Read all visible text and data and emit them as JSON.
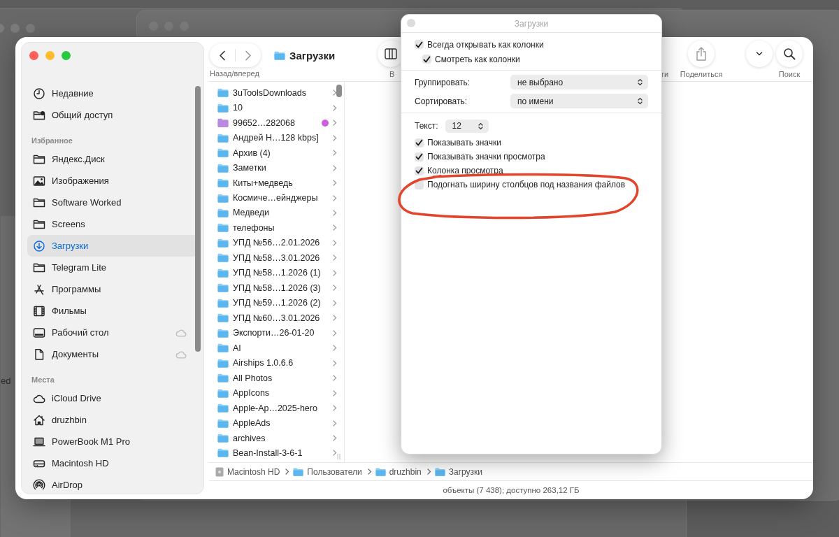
{
  "background": {
    "text": "ed"
  },
  "finder": {
    "sidebar": [
      {
        "items": [
          {
            "label": "Недавние",
            "kind": "clock",
            "selected": false,
            "icloud": false
          },
          {
            "label": "Общий доступ",
            "kind": "shared",
            "selected": false,
            "icloud": false
          }
        ]
      },
      {
        "header": "Избранное",
        "items": [
          {
            "label": "Яндекс.Диск",
            "kind": "folder",
            "selected": false,
            "icloud": false
          },
          {
            "label": "Изображения",
            "kind": "photos",
            "selected": false,
            "icloud": false
          },
          {
            "label": "Software Worked",
            "kind": "folder",
            "selected": false,
            "icloud": false
          },
          {
            "label": "Screens",
            "kind": "folder",
            "selected": false,
            "icloud": false
          },
          {
            "label": "Загрузки",
            "kind": "download",
            "selected": true,
            "icloud": false
          },
          {
            "label": "Telegram Lite",
            "kind": "folder",
            "selected": false,
            "icloud": false
          },
          {
            "label": "Программы",
            "kind": "apps",
            "selected": false,
            "icloud": false
          },
          {
            "label": "Фильмы",
            "kind": "film",
            "selected": false,
            "icloud": false
          },
          {
            "label": "Рабочий стол",
            "kind": "desktop",
            "selected": false,
            "icloud": true
          },
          {
            "label": "Документы",
            "kind": "document",
            "selected": false,
            "icloud": true
          }
        ]
      },
      {
        "header": "Места",
        "items": [
          {
            "label": "iCloud Drive",
            "kind": "cloud",
            "selected": false,
            "icloud": false
          },
          {
            "label": "druzhbin",
            "kind": "home",
            "selected": false,
            "icloud": false
          },
          {
            "label": "PowerBook M1 Pro",
            "kind": "laptop",
            "selected": false,
            "icloud": false
          },
          {
            "label": "Macintosh HD",
            "kind": "disk",
            "selected": false,
            "icloud": false
          },
          {
            "label": "AirDrop",
            "kind": "airdrop",
            "selected": false,
            "icloud": false
          }
        ]
      }
    ],
    "toolbar": {
      "nav_label": "Назад/вперед",
      "title": "Загрузки",
      "items": [
        {
          "kind": "view",
          "label": "В"
        },
        {
          "kind": "tags",
          "label": "ги"
        },
        {
          "kind": "share",
          "label": "Поделиться"
        },
        {
          "kind": "more"
        },
        {
          "kind": "search",
          "label": "Поиск"
        }
      ]
    },
    "column": [
      {
        "name": "3uToolsDownloads"
      },
      {
        "name": "10"
      },
      {
        "name": "99652…282068",
        "color": "#cf5fe0"
      },
      {
        "name": "Андрей Н…128 kbps]"
      },
      {
        "name": "Архив (4)"
      },
      {
        "name": "Заметки"
      },
      {
        "name": "Киты+медведь"
      },
      {
        "name": "Космиче…ейнджеры"
      },
      {
        "name": "Медведи"
      },
      {
        "name": "телефоны"
      },
      {
        "name": "УПД №56…2.01.2026"
      },
      {
        "name": "УПД №58…3.01.2026"
      },
      {
        "name": "УПД №58…1.2026 (1)"
      },
      {
        "name": "УПД №58…1.2026 (3)"
      },
      {
        "name": "УПД №59…1.2026 (2)"
      },
      {
        "name": "УПД №60…3.01.2026"
      },
      {
        "name": "Экспорти…26-01-20"
      },
      {
        "name": "AI"
      },
      {
        "name": "Airships 1.0.6.6"
      },
      {
        "name": "All Photos"
      },
      {
        "name": "AppIcons"
      },
      {
        "name": "Apple-Ap…2025-hero"
      },
      {
        "name": "AppleAds"
      },
      {
        "name": "archives"
      },
      {
        "name": "Bean-Install-3-6-1"
      }
    ],
    "path": [
      {
        "label": "Macintosh HD",
        "kind": "disk"
      },
      {
        "label": "Пользователи",
        "kind": "folder"
      },
      {
        "label": "druzhbin",
        "kind": "home"
      },
      {
        "label": "Загрузки",
        "kind": "download"
      }
    ],
    "status": "объекты (7 438); доступно 263,12 ГБ"
  },
  "view_options": {
    "title": "Загрузки",
    "top_options": [
      {
        "label": "Всегда открывать как колонки",
        "checked": true,
        "children": [
          {
            "label": "Смотреть как колонки",
            "checked": true
          }
        ]
      }
    ],
    "selects": [
      {
        "label": "Группировать:",
        "value": "не выбрано"
      },
      {
        "label": "Сортировать:",
        "value": "по имени"
      }
    ],
    "text_size": {
      "label": "Текст:",
      "value": "12"
    },
    "options": [
      {
        "label": "Показывать значки",
        "checked": true
      },
      {
        "label": "Показывать значки просмотра",
        "checked": true
      },
      {
        "label": "Колонка просмотра",
        "checked": true
      },
      {
        "label": "Подогнать ширину столбцов под названия файлов",
        "checked": false
      }
    ]
  },
  "annotation": {
    "kind": "ellipse",
    "color": "#e2452b"
  }
}
